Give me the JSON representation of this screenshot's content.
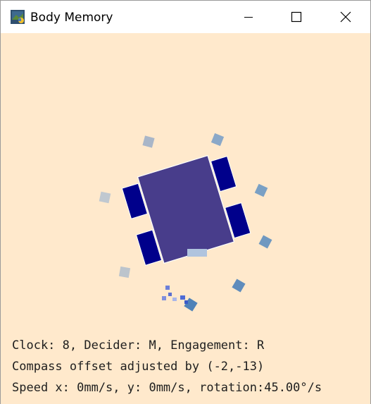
{
  "window": {
    "title": "Body Memory",
    "icon": "python-app-icon",
    "controls": [
      "minimize-icon",
      "maximize-icon",
      "close-icon"
    ]
  },
  "status": {
    "line1": "Clock: 8, Decider: M, Engagement: R",
    "line2": "Compass offset adjusted by (-2,-13)",
    "line3": "Speed x: 0mm/s, y: 0mm/s, rotation:45.00°/s"
  },
  "colors": {
    "background": "#ffe9cc",
    "robot_body": "#483d8b",
    "wheels": "#00008b",
    "heading_marker": "#b0c4de",
    "memory_markers": [
      "#a9b6c8",
      "#8aa8c8",
      "#7aa0c4",
      "#6f98c0",
      "#5f8cbc",
      "#4f82b8",
      "#c0c8d0",
      "#bcc4cc"
    ]
  }
}
